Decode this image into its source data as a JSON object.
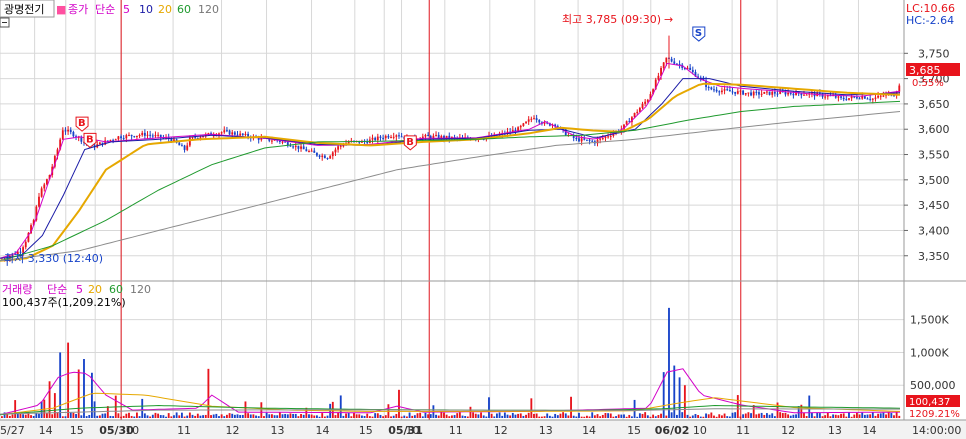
{
  "window": {
    "stock_name": "광명전기",
    "price_legend": {
      "prefix": "종가",
      "method": "단순",
      "periods": [
        "5",
        "10",
        "20",
        "60",
        "120"
      ]
    },
    "volume_legend": {
      "prefix": "거래량",
      "method": "단순",
      "periods": [
        "5",
        "20",
        "60",
        "120"
      ]
    },
    "volume_info": "100,437주(1,209.21%)",
    "lc_text": "LC:10.66",
    "hc_text": "HC:-2.64",
    "high_annotation": "최고 3,785 (09:30)",
    "low_annotation": "최저 3,330 (12:40)",
    "current_price_label": "3,685",
    "current_change_label": "0.55%",
    "current_volume_label": "100,437",
    "current_volume_pct": "1209.21%",
    "time_label": "14:00:00",
    "marker_letters": [
      "B",
      "B",
      "B",
      "S"
    ]
  },
  "colors": {
    "up": "#e8141c",
    "down": "#1743c9",
    "ma5": "#d200c8",
    "ma10": "#1a1aa6",
    "ma20": "#e6a800",
    "ma60": "#1f9a2e",
    "ma120": "#8c8c8c",
    "session": "#e0141c",
    "grid": "#d8d8d8"
  },
  "chart_data": [
    {
      "type": "line",
      "title": "광명전기",
      "subtitle": "종가 단순 5 10 20 60 120",
      "y_axis_ticks": [
        "3,350",
        "3,400",
        "3,450",
        "3,500",
        "3,550",
        "3,600",
        "3,650",
        "3,700",
        "3,750"
      ],
      "ylim": [
        3310,
        3800
      ],
      "sessions": [
        "05/27",
        "05/30",
        "05/31",
        "06/02"
      ],
      "x_tick_labels": [
        "5/27",
        "14",
        "15",
        "05/30",
        "10",
        "11",
        "12",
        "13",
        "14",
        "15",
        "05/31",
        "10",
        "11",
        "12",
        "13",
        "14",
        "15",
        "06/02",
        "10",
        "11",
        "12",
        "13",
        "14"
      ],
      "series": [
        {
          "name": "종가",
          "x": [
            0,
            4,
            8,
            10,
            13,
            15,
            19,
            22,
            24,
            28,
            35,
            45,
            55,
            65,
            70,
            72,
            75,
            85,
            95,
            100,
            105,
            110,
            115,
            120,
            124,
            128,
            132,
            138,
            145,
            150,
            155,
            160,
            165,
            172,
            178,
            186,
            190,
            196,
            202,
            206,
            210,
            212,
            215,
            218,
            225,
            235,
            245,
            252,
            260,
            265,
            268,
            275,
            285,
            295,
            305,
            315,
            318,
            322,
            326,
            330,
            333,
            336,
            338,
            340
          ],
          "y": [
            3340,
            3350,
            3360,
            3380,
            3420,
            3470,
            3510,
            3560,
            3600,
            3590,
            3565,
            3585,
            3590,
            3580,
            3560,
            3580,
            3585,
            3595,
            3585,
            3580,
            3578,
            3570,
            3560,
            3550,
            3545,
            3565,
            3575,
            3575,
            3585,
            3590,
            3580,
            3585,
            3585,
            3582,
            3582,
            3585,
            3590,
            3600,
            3625,
            3610,
            3610,
            3600,
            3588,
            3580,
            3575,
            3600,
            3660,
            3740,
            3720,
            3700,
            3680,
            3675,
            3670,
            3672,
            3670,
            3665,
            3660,
            3662,
            3665,
            3660,
            3665,
            3670,
            3670,
            3685
          ]
        },
        {
          "name": "5",
          "x": [
            0,
            6,
            12,
            18,
            24,
            30,
            40,
            60,
            80,
            100,
            120,
            140,
            160,
            180,
            200,
            206,
            212,
            218,
            225,
            235,
            245,
            252,
            258,
            264,
            272,
            282,
            295,
            310,
            325,
            340
          ],
          "y": [
            3345,
            3355,
            3400,
            3490,
            3580,
            3585,
            3575,
            3583,
            3590,
            3582,
            3568,
            3570,
            3582,
            3583,
            3600,
            3615,
            3600,
            3585,
            3580,
            3598,
            3650,
            3730,
            3725,
            3700,
            3685,
            3680,
            3675,
            3668,
            3665,
            3675
          ]
        },
        {
          "name": "10",
          "x": [
            0,
            8,
            16,
            24,
            32,
            42,
            60,
            80,
            100,
            120,
            140,
            160,
            180,
            200,
            212,
            225,
            240,
            250,
            258,
            268,
            280,
            300,
            320,
            340
          ],
          "y": [
            3345,
            3350,
            3390,
            3470,
            3560,
            3575,
            3580,
            3588,
            3583,
            3570,
            3568,
            3580,
            3582,
            3598,
            3600,
            3583,
            3600,
            3650,
            3700,
            3700,
            3685,
            3675,
            3668,
            3672
          ]
        },
        {
          "name": "20",
          "x": [
            0,
            10,
            20,
            30,
            40,
            55,
            75,
            100,
            120,
            140,
            160,
            180,
            200,
            212,
            225,
            235,
            245,
            255,
            265,
            280,
            300,
            320,
            340
          ],
          "y": [
            3340,
            3345,
            3370,
            3440,
            3520,
            3570,
            3580,
            3585,
            3573,
            3568,
            3575,
            3580,
            3592,
            3603,
            3597,
            3595,
            3620,
            3665,
            3690,
            3688,
            3680,
            3672,
            3668
          ]
        },
        {
          "name": "60",
          "x": [
            0,
            20,
            40,
            60,
            80,
            100,
            120,
            140,
            160,
            180,
            200,
            220,
            240,
            260,
            280,
            300,
            320,
            340
          ],
          "y": [
            3340,
            3370,
            3420,
            3480,
            3530,
            3563,
            3575,
            3576,
            3578,
            3580,
            3585,
            3588,
            3598,
            3618,
            3635,
            3645,
            3650,
            3655
          ]
        },
        {
          "name": "120",
          "x": [
            0,
            30,
            60,
            90,
            120,
            150,
            180,
            210,
            240,
            270,
            300,
            320,
            340
          ],
          "y": [
            3340,
            3360,
            3400,
            3440,
            3480,
            3520,
            3545,
            3568,
            3580,
            3598,
            3615,
            3625,
            3635
          ]
        }
      ],
      "extremes": {
        "high": {
          "x": 252,
          "y": 3785
        },
        "low": {
          "x": 2,
          "y": 3330
        }
      }
    },
    {
      "type": "bar",
      "title": "거래량",
      "subtitle": "거래량 단순 5 20 60 120",
      "y_axis_ticks": [
        "500,000",
        "1,000K",
        "1,500K"
      ],
      "ylim": [
        0,
        1800000
      ],
      "spikes": [
        {
          "x": 22,
          "value": 1000000
        },
        {
          "x": 25,
          "value": 1150000
        },
        {
          "x": 29,
          "value": 740000
        },
        {
          "x": 31,
          "value": 900000
        },
        {
          "x": 34,
          "value": 690000
        },
        {
          "x": 18,
          "value": 560000
        },
        {
          "x": 20,
          "value": 380000
        },
        {
          "x": 15,
          "value": 250000
        },
        {
          "x": 78,
          "value": 750000
        },
        {
          "x": 150,
          "value": 430000
        },
        {
          "x": 146,
          "value": 210000
        },
        {
          "x": 200,
          "value": 300000
        },
        {
          "x": 252,
          "value": 1680000
        },
        {
          "x": 254,
          "value": 800000
        },
        {
          "x": 256,
          "value": 620000
        },
        {
          "x": 258,
          "value": 500000
        },
        {
          "x": 250,
          "value": 700000
        },
        {
          "x": 278,
          "value": 350000
        },
        {
          "x": 340,
          "value": 100437
        }
      ],
      "baseline_volume": 60000,
      "series": [
        {
          "name": "5",
          "x": [
            0,
            15,
            22,
            27,
            33,
            40,
            50,
            75,
            80,
            90,
            140,
            150,
            160,
            200,
            245,
            252,
            258,
            265,
            280,
            300,
            340
          ],
          "y": [
            50000,
            200000,
            620000,
            700000,
            680000,
            350000,
            120000,
            150000,
            350000,
            90000,
            80000,
            180000,
            90000,
            100000,
            150000,
            700000,
            750000,
            350000,
            200000,
            80000,
            90000
          ]
        },
        {
          "name": "20",
          "x": [
            0,
            20,
            35,
            55,
            80,
            110,
            140,
            170,
            200,
            240,
            255,
            270,
            300,
            340
          ],
          "y": [
            50000,
            150000,
            380000,
            350000,
            180000,
            120000,
            100000,
            100000,
            100000,
            110000,
            220000,
            310000,
            160000,
            100000
          ]
        },
        {
          "name": "60",
          "x": [
            0,
            30,
            60,
            100,
            140,
            180,
            220,
            250,
            270,
            300,
            340
          ],
          "y": [
            50000,
            150000,
            190000,
            150000,
            130000,
            120000,
            115000,
            140000,
            190000,
            170000,
            150000
          ]
        },
        {
          "name": "120",
          "x": [
            0,
            60,
            120,
            180,
            240,
            270,
            340
          ],
          "y": [
            60000,
            120000,
            125000,
            120000,
            115000,
            140000,
            135000
          ]
        }
      ]
    }
  ]
}
